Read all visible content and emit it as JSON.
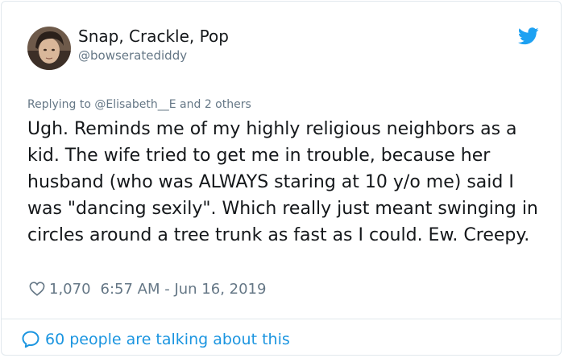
{
  "author": {
    "display_name": "Snap, Crackle, Pop",
    "handle": "@bowseratediddy",
    "avatar_icon": "user-avatar"
  },
  "reply_context": "Replying to @Elisabeth__E and 2 others",
  "tweet": {
    "text": "Ugh. Reminds me of my highly religious neighbors as a kid. The wife tried to get me in trouble, because her husband (who was ALWAYS staring at 10 y/o me) said I was \"dancing sexily\". Which really just meant swinging in circles around a tree trunk as fast as I could. Ew. Creepy."
  },
  "meta": {
    "like_count": "1,070",
    "timestamp": "6:57 AM - Jun 16, 2019"
  },
  "footer": {
    "label": "60 people are talking about this"
  },
  "icons": {
    "brand": "twitter-bird-icon",
    "like": "heart-icon",
    "conversation": "speech-bubble-icon"
  },
  "colors": {
    "twitter_blue": "#1da1f2",
    "link_blue": "#1b95e0",
    "secondary_text": "#657786",
    "primary_text": "#14171a",
    "border": "#e1e8ed"
  }
}
